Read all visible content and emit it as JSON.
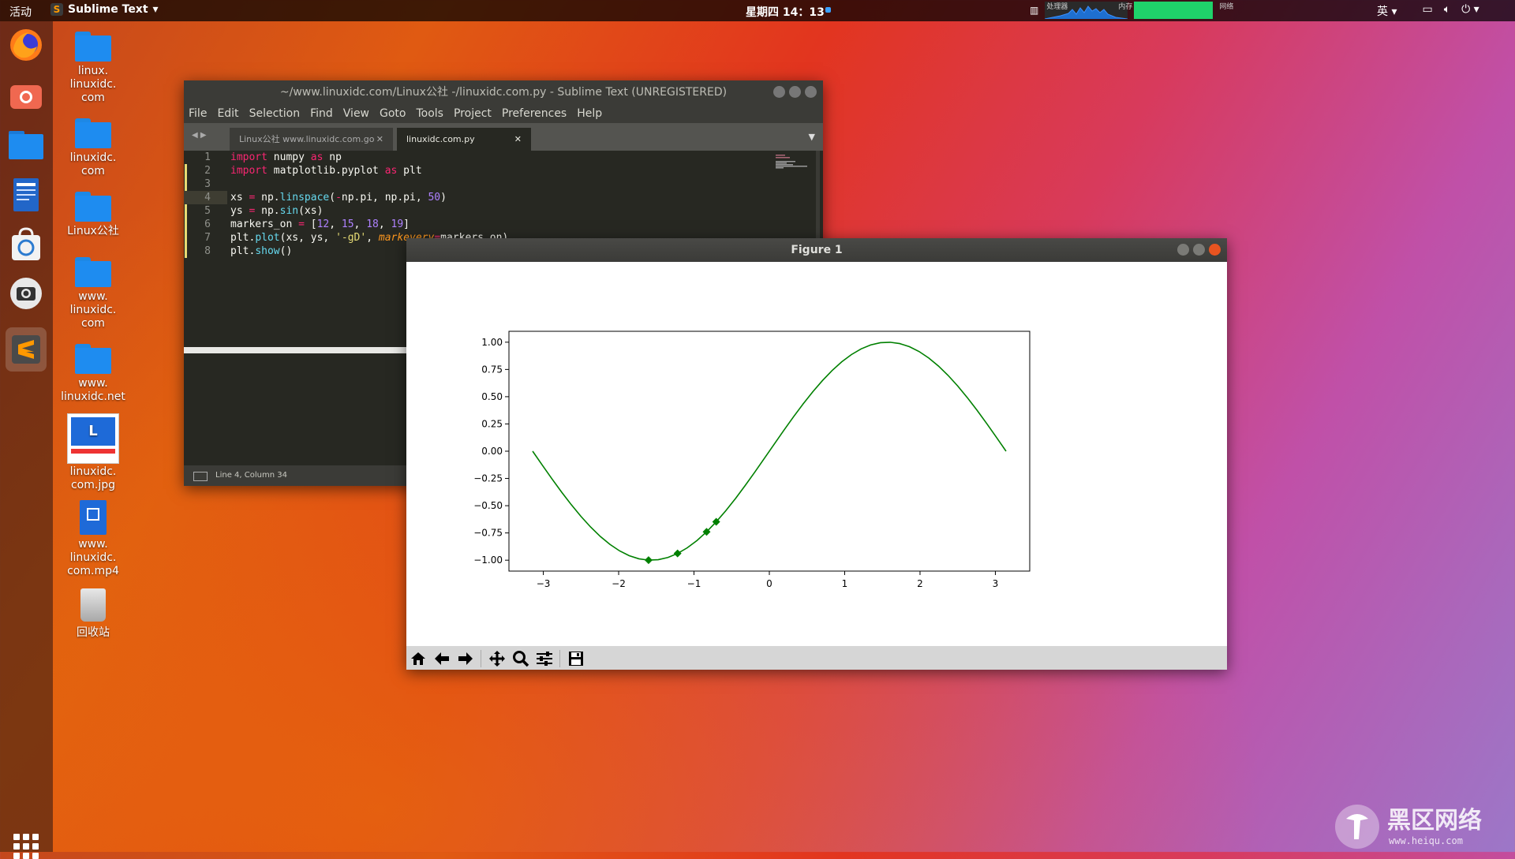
{
  "topbar": {
    "activities": "活动",
    "app_name": "Sublime Text",
    "clock": "星期四 14：13",
    "cpu_label": "处理器",
    "mem_label": "内存",
    "net_label": "网络",
    "input_method": "英"
  },
  "desktop": {
    "icons": [
      {
        "label": "linux.\nlinuxidc.\ncom",
        "lines": [
          "linux.",
          "linuxidc.",
          "com"
        ],
        "type": "folder"
      },
      {
        "lines": [
          "linuxidc.",
          "com"
        ],
        "type": "folder"
      },
      {
        "lines": [
          "Linux公社"
        ],
        "type": "folder"
      },
      {
        "lines": [
          "www.",
          "linuxidc.",
          "com"
        ],
        "type": "folder"
      },
      {
        "lines": [
          "www.",
          "linuxidc.net"
        ],
        "type": "folder"
      },
      {
        "lines": [
          "linuxidc.",
          "com.jpg"
        ],
        "type": "image"
      },
      {
        "lines": [
          "www.",
          "linuxidc.",
          "com.mp4"
        ],
        "type": "video"
      },
      {
        "lines": [
          "回收站"
        ],
        "type": "trash"
      }
    ]
  },
  "sublime": {
    "title": "~/www.linuxidc.com/Linux公社 -/linuxidc.com.py - Sublime Text (UNREGISTERED)",
    "menu": [
      "File",
      "Edit",
      "Selection",
      "Find",
      "View",
      "Goto",
      "Tools",
      "Project",
      "Preferences",
      "Help"
    ],
    "tabs": [
      {
        "label": "Linux公社 www.linuxidc.com.go",
        "active": false
      },
      {
        "label": "linuxidc.com.py",
        "active": true
      }
    ],
    "line_numbers": [
      "1",
      "2",
      "3",
      "4",
      "5",
      "6",
      "7",
      "8"
    ],
    "status": "Line 4, Column 34"
  },
  "figure": {
    "title": "Figure 1"
  },
  "chart_data": {
    "type": "line",
    "title": "",
    "xlabel": "",
    "ylabel": "",
    "xlim": [
      -3.456,
      3.456
    ],
    "ylim": [
      -1.1,
      1.1
    ],
    "xticks": [
      -3,
      -2,
      -1,
      0,
      1,
      2,
      3
    ],
    "xtick_labels": [
      "−3",
      "−2",
      "−1",
      "0",
      "1",
      "2",
      "3"
    ],
    "yticks": [
      1.0,
      0.75,
      0.5,
      0.25,
      0.0,
      -0.25,
      -0.5,
      -0.75,
      -1.0
    ],
    "ytick_labels": [
      "1.00",
      "0.75",
      "0.50",
      "0.25",
      "0.00",
      "−0.25",
      "−0.50",
      "−0.75",
      "−1.00"
    ],
    "color": "#008000",
    "series": [
      {
        "function": "sin",
        "x_start": -3.14159,
        "x_end": 3.14159,
        "num_points": 50,
        "markers": [
          {
            "x": -1.603,
            "y": -0.9995
          },
          {
            "x": -1.218,
            "y": -0.938
          },
          {
            "x": -0.833,
            "y": -0.74
          },
          {
            "x": -0.705,
            "y": -0.648
          }
        ]
      }
    ],
    "grid": false,
    "legend": "none"
  }
}
